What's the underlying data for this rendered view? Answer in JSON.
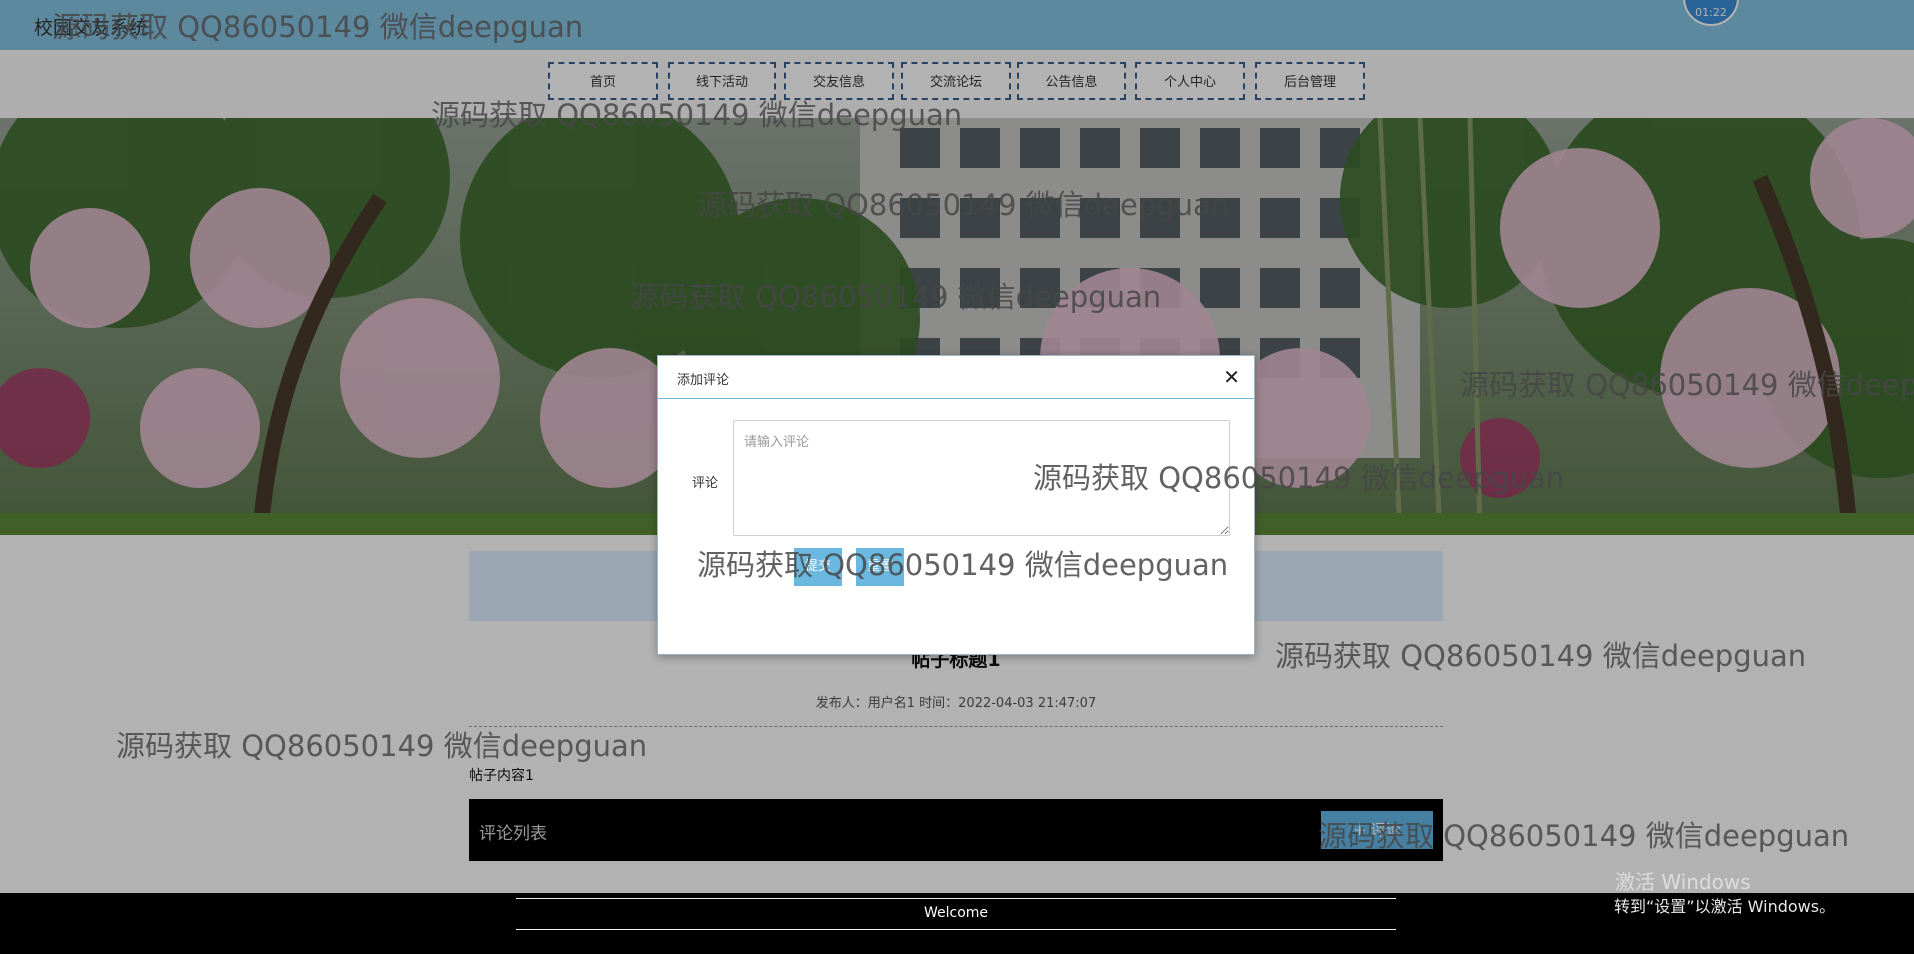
{
  "header": {
    "site_title": "校园交友系统",
    "clock_text": "01:22"
  },
  "nav": {
    "items": [
      "首页",
      "线下活动",
      "交友信息",
      "交流论坛",
      "公告信息",
      "个人中心",
      "后台管理"
    ]
  },
  "post": {
    "title": "帖子标题1",
    "meta": "发布人：用户名1 时间：2022-04-03 21:47:07",
    "content": "帖子内容1"
  },
  "comments": {
    "list_title": "评论列表",
    "add_label": "+ 评论"
  },
  "modal": {
    "title": "添加评论",
    "field_label": "评论",
    "placeholder": "请输入评论",
    "submit_label": "提交",
    "reset_label": "重置"
  },
  "footer": {
    "text": "Welcome"
  },
  "watermark": {
    "text": "源码获取 QQ86050149 微信deepguan"
  },
  "windows_activation": {
    "line1": "激活 Windows",
    "line2": "转到“设置”以激活 Windows。"
  },
  "colors": {
    "topbar": "#86c5e4",
    "nav_border": "#3a5f8f",
    "button": "#6ab8e0",
    "footer": "#000000"
  }
}
